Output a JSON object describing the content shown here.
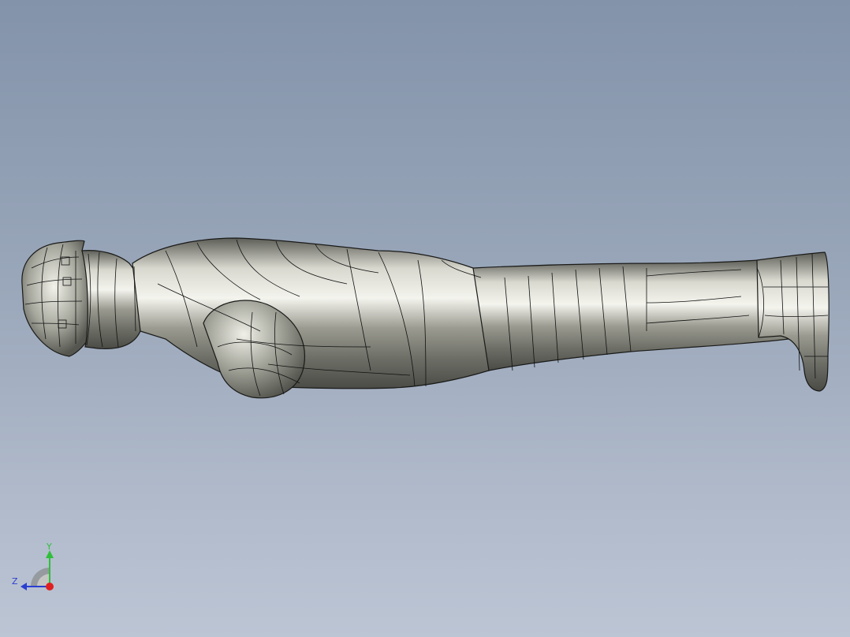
{
  "viewport": {
    "background_top": "#8393aa",
    "background_bottom": "#bcc5d4",
    "model_name": "worker-figure",
    "model_color": "#a9aa9f"
  },
  "triad": {
    "y_label": "Y",
    "z_label": "Z",
    "y_color": "#2fbf3a",
    "z_color": "#2a3fd0",
    "x_color": "#e02020"
  }
}
